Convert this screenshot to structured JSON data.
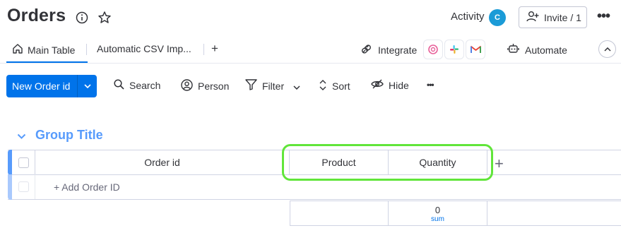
{
  "header": {
    "title": "Orders",
    "activity_label": "Activity",
    "avatar_initial": "C",
    "invite_label": "Invite / 1",
    "more_label": "•••"
  },
  "tabs": {
    "items": [
      {
        "label": "Main Table",
        "active": true
      },
      {
        "label": "Automatic CSV Imp..."
      }
    ],
    "add_label": "+",
    "integrate_label": "Integrate",
    "automate_label": "Automate"
  },
  "toolbar": {
    "new_label": "New Order id",
    "search_label": "Search",
    "person_label": "Person",
    "filter_label": "Filter",
    "sort_label": "Sort",
    "hide_label": "Hide",
    "more_label": "•••"
  },
  "group": {
    "title": "Group Title",
    "color": "#579bfc",
    "columns": [
      "Order id",
      "Product",
      "Quantity"
    ],
    "add_column_label": "+",
    "add_item_label": "+ Add Order ID",
    "summary": {
      "value": "0",
      "label": "sum"
    }
  },
  "colors": {
    "accent": "#0073ea",
    "group": "#579bfc",
    "highlight": "#61e53a",
    "avatar": "#1b9bd7"
  }
}
